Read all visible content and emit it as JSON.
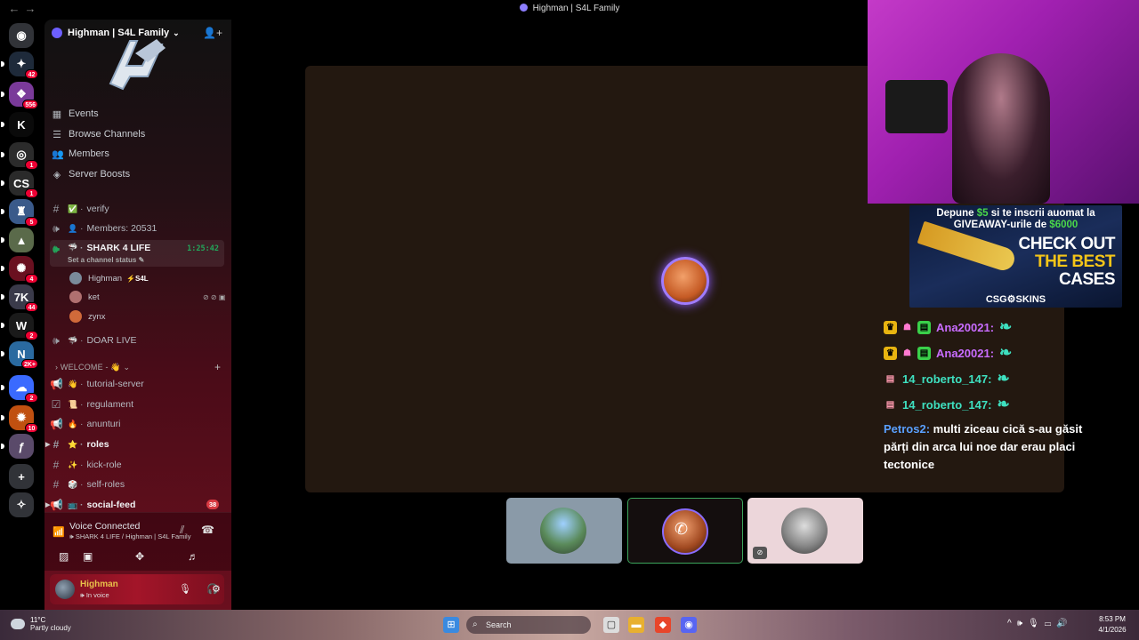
{
  "window": {
    "title": "Highman | S4L Family"
  },
  "rail": {
    "items": [
      {
        "name": "discord-home-icon",
        "badge": "",
        "color": "#313338",
        "glyph": "◉"
      },
      {
        "name": "server-1-icon",
        "badge": "42",
        "color": "#1e2a3a",
        "glyph": "✦"
      },
      {
        "name": "server-2-icon",
        "badge": "556",
        "color": "#7a3a9a",
        "glyph": "❖"
      },
      {
        "name": "server-kick-icon",
        "badge": "",
        "color": "#0a0a0a",
        "glyph": "K"
      },
      {
        "name": "server-4-icon",
        "badge": "1",
        "color": "#2b2b2b",
        "glyph": "◎"
      },
      {
        "name": "server-csgoskins-icon",
        "badge": "1",
        "color": "#2a2a2a",
        "glyph": "CS"
      },
      {
        "name": "server-6-icon",
        "badge": "5",
        "color": "#3a5a8a",
        "glyph": "♜"
      },
      {
        "name": "server-7-icon",
        "badge": "",
        "color": "#5a6a4a",
        "glyph": "▲"
      },
      {
        "name": "server-8-icon",
        "badge": "4",
        "color": "#6a1020",
        "glyph": "✺"
      },
      {
        "name": "server-9-icon",
        "badge": "44",
        "color": "#3a3a4a",
        "glyph": "7K"
      },
      {
        "name": "server-10-icon",
        "badge": "2",
        "color": "#1a1a1a",
        "glyph": "W"
      },
      {
        "name": "server-11-icon",
        "badge": "2K+",
        "color": "#2a6aa0",
        "glyph": "N"
      },
      {
        "name": "server-12-icon",
        "badge": "2",
        "color": "#3a6aff",
        "glyph": "☁"
      },
      {
        "name": "server-13-icon",
        "badge": "10",
        "color": "#c05010",
        "glyph": "✹"
      },
      {
        "name": "server-14-icon",
        "badge": "",
        "color": "#5a4a6a",
        "glyph": "ƒ"
      },
      {
        "name": "add-server-icon",
        "badge": "",
        "color": "#313338",
        "glyph": "+"
      },
      {
        "name": "discover-icon",
        "badge": "",
        "color": "#313338",
        "glyph": "✧"
      }
    ]
  },
  "server": {
    "name": "Highman | S4L Family",
    "logo_text": "S4L",
    "menu": [
      {
        "label": "Events",
        "glyph": "▦"
      },
      {
        "label": "Browse Channels",
        "glyph": "☰"
      },
      {
        "label": "Members",
        "glyph": "👥"
      },
      {
        "label": "Server Boosts",
        "glyph": "◈"
      }
    ]
  },
  "channels": {
    "verify": {
      "label": "verify",
      "emoji": "✅"
    },
    "members": {
      "label": "Members: 20531",
      "emoji": "👤"
    },
    "shark": {
      "label": "SHARK 4 LIFE",
      "emoji": "🦈",
      "timer": "1:25:42",
      "status": "Set a channel status"
    },
    "voice_users": [
      {
        "name": "Highman",
        "tag": "⚡S4L",
        "color": "#7a8a9a"
      },
      {
        "name": "ket",
        "tag": "",
        "color": "#b07070",
        "icons": "⊘ ⊘ ▣"
      },
      {
        "name": "zynx",
        "tag": "",
        "color": "#d06a3a"
      }
    ],
    "doar_live": {
      "label": "DOAR LIVE",
      "emoji": "🦈"
    },
    "category_welcome": "WELCOME - 👋",
    "list": [
      {
        "label": "tutorial-server",
        "emoji": "👋",
        "bold": false
      },
      {
        "label": "regulament",
        "emoji": "📜",
        "bold": false
      },
      {
        "label": "anunturi",
        "emoji": "🔥",
        "bold": false
      },
      {
        "label": "roles",
        "emoji": "⭐",
        "bold": true
      },
      {
        "label": "kick-role",
        "emoji": "✨",
        "bold": false
      },
      {
        "label": "self-roles",
        "emoji": "🎲",
        "bold": false
      },
      {
        "label": "social-feed",
        "emoji": "📺",
        "bold": true,
        "badge": "38"
      }
    ]
  },
  "voice": {
    "title": "Voice Connected",
    "subtitle": "SHARK 4 LIFE / Highman | S4L Family"
  },
  "user": {
    "name": "Highman",
    "status": "In voice"
  },
  "chat": {
    "messages": [
      {
        "name": "Ana20021:",
        "color": "#c96cff"
      },
      {
        "name": "Ana20021:",
        "color": "#c96cff"
      },
      {
        "name": "14_roberto_147:",
        "color": "#3ee0c0"
      },
      {
        "name": "14_roberto_147:",
        "color": "#3ee0c0"
      }
    ],
    "petros_name": "Petros2:",
    "petros_text": "multi ziceau cică s-au găsit părți din arca lui noe dar erau placi tectonice"
  },
  "ad": {
    "line1a": "Depune",
    "line1b": "$5",
    "line1c": "si te inscrii auomat la",
    "line2a": "GIVEAWAY-urile de",
    "line2b": "$6000",
    "big1": "CHECK OUT",
    "big2": "THE BEST",
    "big3": "CASES",
    "brand": "CSG⚙SKINS"
  },
  "taskbar": {
    "temp": "11°C",
    "weather": "Partly cloudy",
    "search": "Search",
    "time": "8:53 PM",
    "date": "4/1/2026"
  }
}
